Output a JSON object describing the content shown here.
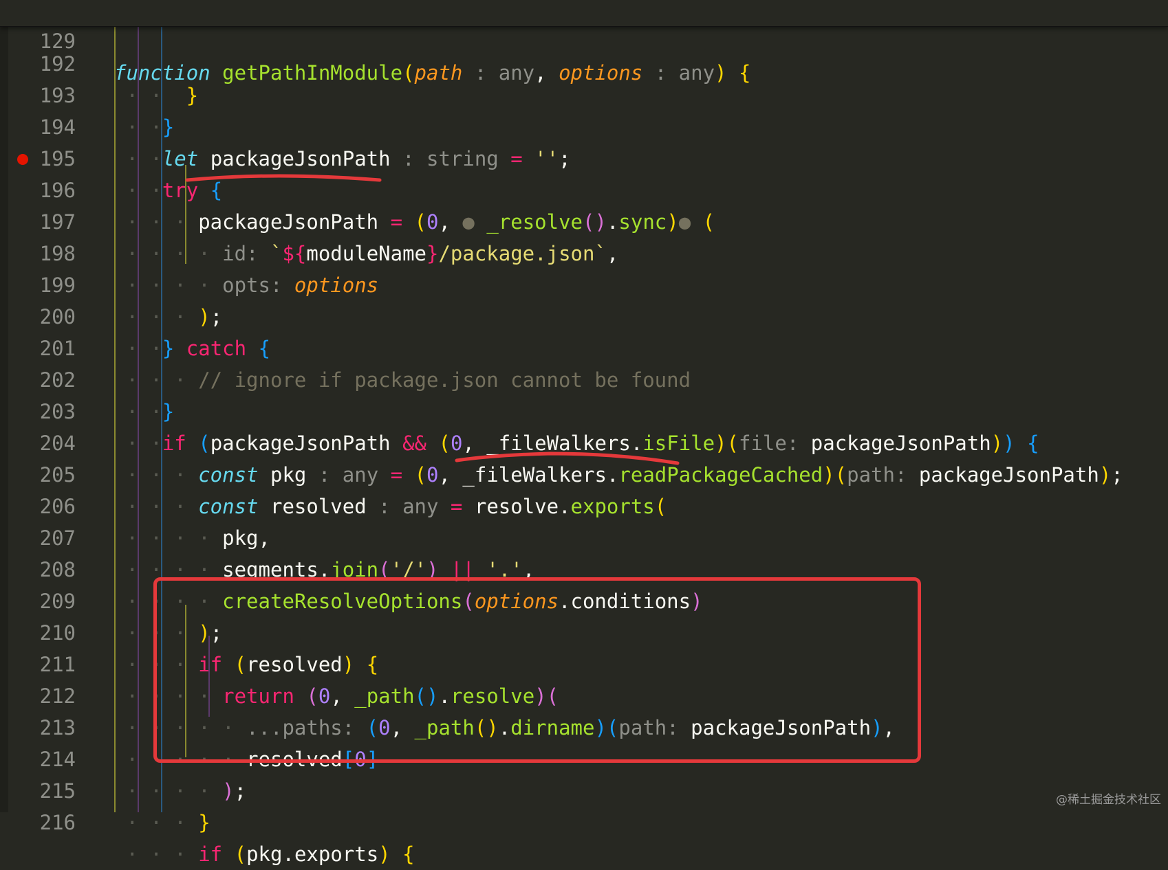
{
  "sticky_header": {
    "line_number": "129",
    "kw": "function",
    "fn": "getPathInModule",
    "p1": "path",
    "t1": " : any",
    "p2": "options",
    "t2": " : any"
  },
  "lines": {
    "l192": {
      "n": "192"
    },
    "l193": {
      "n": "193"
    },
    "l194": {
      "n": "194",
      "kw": "let",
      "id": "packageJsonPath",
      "hint": " : string",
      "val": "''"
    },
    "l195": {
      "n": "195",
      "kw": "try"
    },
    "l196": {
      "n": "196",
      "id": "packageJsonPath",
      "num": "0",
      "fn": "_resolve",
      "prop": "sync"
    },
    "l197": {
      "n": "197",
      "hint": "id:",
      "tpl_start": "`",
      "tpl_open": "${",
      "expr": "moduleName",
      "tpl_close": "}",
      "tpl_rest": "/package.json`"
    },
    "l198": {
      "n": "198",
      "hint": "opts:",
      "prm": "options"
    },
    "l199": {
      "n": "199"
    },
    "l200": {
      "n": "200",
      "kw": "catch"
    },
    "l201": {
      "n": "201",
      "comment": "// ignore if package.json cannot be found"
    },
    "l202": {
      "n": "202"
    },
    "l203": {
      "n": "203",
      "kw": "if",
      "id": "packageJsonPath",
      "num": "0",
      "obj": "_fileWalkers",
      "fn": "isFile",
      "hint": "file:",
      "arg": "packageJsonPath"
    },
    "l204": {
      "n": "204",
      "kw": "const",
      "id": "pkg",
      "hint": " : any",
      "num": "0",
      "obj": "_fileWalkers",
      "fn": "readPackageCached",
      "phint": "path:",
      "arg": "packageJsonPath"
    },
    "l205": {
      "n": "205",
      "kw": "const",
      "id": "resolved",
      "hint": " : any",
      "obj": "resolve",
      "fn": "exports"
    },
    "l206": {
      "n": "206",
      "id": "pkg"
    },
    "l207": {
      "n": "207",
      "obj": "segments",
      "fn": "join",
      "s1": "'/'",
      "s2": "'.'"
    },
    "l208": {
      "n": "208",
      "fn": "createResolveOptions",
      "prm": "options",
      "prop": "conditions"
    },
    "l209": {
      "n": "209"
    },
    "l210": {
      "n": "210",
      "kw": "if",
      "id": "resolved"
    },
    "l211": {
      "n": "211",
      "kw": "return",
      "num": "0",
      "fn": "_path",
      "prop": "resolve"
    },
    "l212": {
      "n": "212",
      "hint": "...paths:",
      "num": "0",
      "fn": "_path",
      "prop": "dirname",
      "phint": "path:",
      "arg": "packageJsonPath"
    },
    "l213": {
      "n": "213",
      "id": "resolved",
      "num": "0"
    },
    "l214": {
      "n": "214"
    },
    "l215": {
      "n": "215"
    },
    "l216": {
      "n": "216",
      "kw": "if",
      "obj": "pkg",
      "prop": "exports"
    }
  },
  "watermark": "@稀土掘金技术社区",
  "colors": {
    "background": "#272822",
    "keyword": "#f92672",
    "function": "#a6e22e",
    "parameter": "#fd971f",
    "number": "#ae81ff",
    "string": "#e6db74",
    "annotation_red": "#e5393b"
  }
}
